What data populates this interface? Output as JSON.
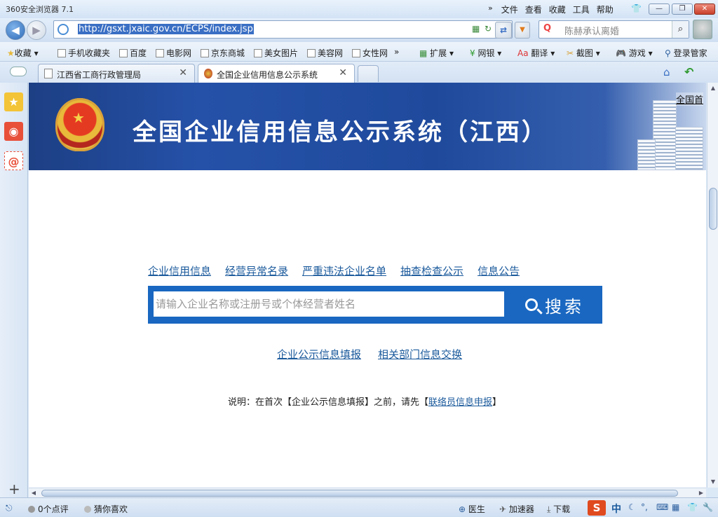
{
  "window": {
    "title": "360安全浏览器 7.1",
    "menus": [
      "文件",
      "查看",
      "收藏",
      "工具",
      "帮助"
    ],
    "more_glyph": "»",
    "controls": {
      "minimize": "—",
      "restore": "❐",
      "close": "✕"
    }
  },
  "addressbar": {
    "url": "http://gsxt.jxaic.gov.cn/ECPS/index.jsp",
    "search_placeholder": "陈赫承认离婚"
  },
  "favorites": {
    "items": [
      "收藏",
      "手机收藏夹",
      "百度",
      "电影网",
      "京东商城",
      "美女图片",
      "美容网",
      "女性网"
    ],
    "more_glyph": "»",
    "tools": [
      "扩展",
      "网银",
      "翻译",
      "截图",
      "游戏",
      "登录管家"
    ]
  },
  "tabs": [
    {
      "label": "江西省工商行政管理局",
      "active": false
    },
    {
      "label": "全国企业信用信息公示系统",
      "active": true
    }
  ],
  "banner": {
    "title": "全国企业信用信息公示系统（江西）",
    "national_link": "全国首"
  },
  "main": {
    "top_links": [
      "企业信用信息",
      "经营异常名录",
      "严重违法企业名单",
      "抽查检查公示",
      "信息公告"
    ],
    "search": {
      "placeholder": "请输入企业名称或注册号或个体经营者姓名",
      "button": "搜索"
    },
    "bottom_links": [
      "企业公示信息填报",
      "相关部门信息交换"
    ],
    "note": {
      "prefix": "说明：在首次【企业公示信息填报】之前，请先【",
      "link": "联络员信息申报",
      "suffix": "】"
    }
  },
  "statusbar": {
    "comments": "0个点评",
    "guess": "猜你喜欢",
    "doctor": "医生",
    "accelerator": "加速器",
    "download": "下载",
    "ime_logo": "S",
    "ime_mode": "中"
  },
  "colors": {
    "banner_blue": "#1f4a9c",
    "search_blue": "#1967c1",
    "link_blue": "#1b5a9c"
  }
}
